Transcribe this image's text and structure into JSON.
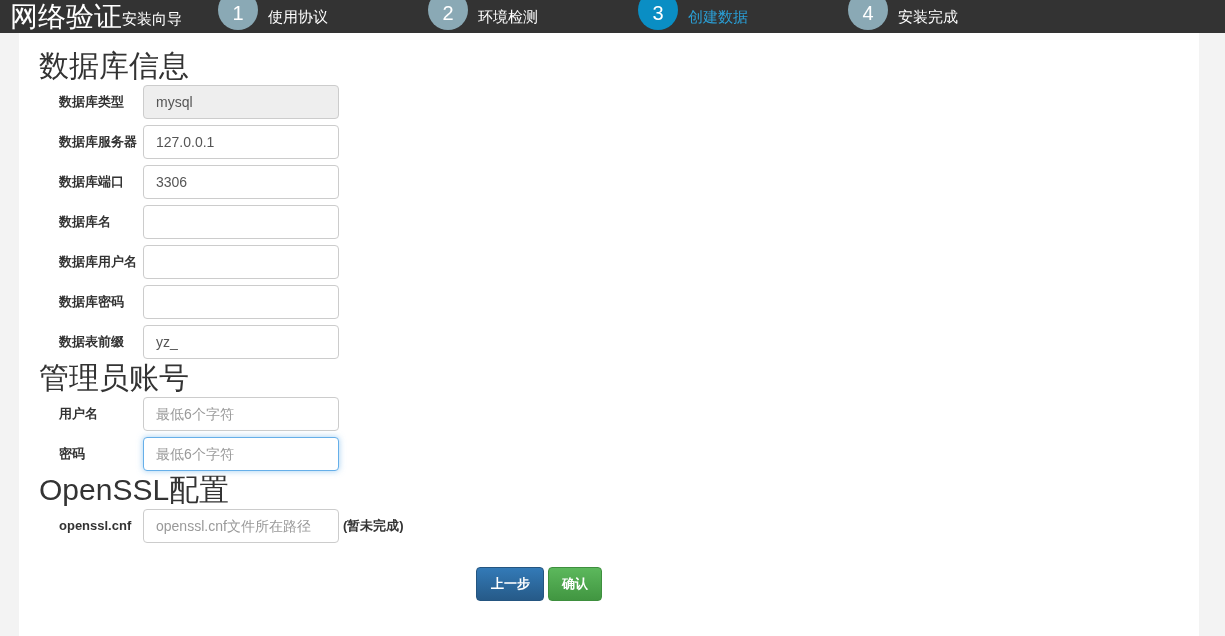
{
  "header": {
    "title": "网络验证",
    "subtitle": "安装向导",
    "steps": [
      {
        "number": "1",
        "label": "使用协议",
        "selected": false
      },
      {
        "number": "2",
        "label": "环境检测",
        "selected": false
      },
      {
        "number": "3",
        "label": "创建数据",
        "selected": true
      },
      {
        "number": "4",
        "label": "安装完成",
        "selected": false
      }
    ]
  },
  "sections": [
    {
      "title": "数据库信息",
      "fields": [
        {
          "label": "数据库类型",
          "value": "mysql",
          "disabled": true,
          "focused": false
        },
        {
          "label": "数据库服务器",
          "value": "127.0.0.1",
          "disabled": false,
          "focused": false
        },
        {
          "label": "数据库端口",
          "value": "3306",
          "disabled": false,
          "focused": false
        },
        {
          "label": "数据库名",
          "disabled": false,
          "focused": false
        },
        {
          "label": "数据库用户名",
          "disabled": false,
          "focused": false
        },
        {
          "label": "数据库密码",
          "disabled": false,
          "focused": false
        },
        {
          "label": "数据表前缀",
          "value": "yz_",
          "disabled": false,
          "focused": false
        }
      ]
    },
    {
      "title": "管理员账号",
      "fields": [
        {
          "label": "用户名",
          "placeholder": "最低6个字符",
          "disabled": false,
          "focused": false
        },
        {
          "label": "密码",
          "placeholder": "最低6个字符",
          "disabled": false,
          "focused": true
        }
      ]
    },
    {
      "title": "OpenSSL配置",
      "fields": [
        {
          "label": "openssl.cnf",
          "placeholder": "openssl.cnf文件所在路径",
          "disabled": false,
          "focused": false,
          "note": "(暂未完成)"
        }
      ]
    }
  ],
  "buttons": [
    {
      "label": "上一步",
      "kind": "primary"
    },
    {
      "label": "确认",
      "kind": "success"
    }
  ]
}
